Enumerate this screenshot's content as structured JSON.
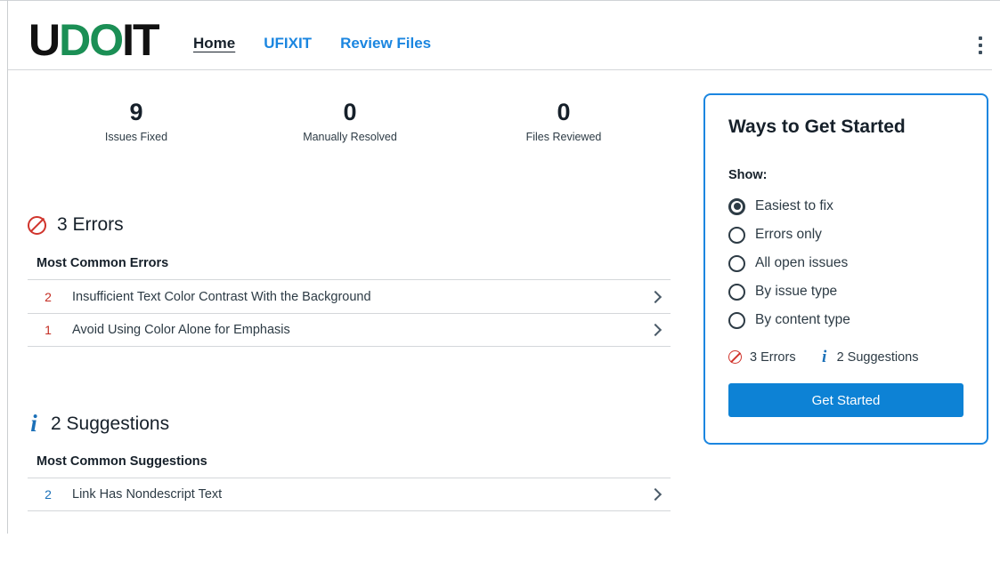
{
  "app": {
    "logo_part1": "U",
    "logo_part2": "DO",
    "logo_part3": "IT",
    "accent_blue": "#1b86e0",
    "error_red": "#d0342c",
    "suggestion_blue": "#1b70b8",
    "button_blue": "#0d82d5",
    "logo_green": "#1b8f55"
  },
  "nav": {
    "items": [
      {
        "label": "Home",
        "active": true
      },
      {
        "label": "UFIXIT",
        "active": false
      },
      {
        "label": "Review Files",
        "active": false
      }
    ],
    "menu_icon": "kebab-menu-icon"
  },
  "stats": [
    {
      "value": "9",
      "label": "Issues Fixed"
    },
    {
      "value": "0",
      "label": "Manually Resolved"
    },
    {
      "value": "0",
      "label": "Files Reviewed"
    }
  ],
  "errors_section": {
    "icon": "error-prohibition-icon",
    "heading": "3 Errors",
    "list_title": "Most Common Errors",
    "rows": [
      {
        "count": "2",
        "label": "Insufficient Text Color Contrast With the Background"
      },
      {
        "count": "1",
        "label": "Avoid Using Color Alone for Emphasis"
      }
    ]
  },
  "suggestions_section": {
    "icon": "info-italic-icon",
    "icon_glyph": "i",
    "heading": "2 Suggestions",
    "list_title": "Most Common Suggestions",
    "rows": [
      {
        "count": "2",
        "label": "Link Has Nondescript Text"
      }
    ]
  },
  "panel": {
    "title": "Ways to Get Started",
    "show_label": "Show:",
    "options": [
      {
        "label": "Easiest to fix",
        "selected": true
      },
      {
        "label": "Errors only",
        "selected": false
      },
      {
        "label": "All open issues",
        "selected": false
      },
      {
        "label": "By issue type",
        "selected": false
      },
      {
        "label": "By content type",
        "selected": false
      }
    ],
    "tally_errors": "3 Errors",
    "tally_suggestions": "2 Suggestions",
    "tally_info_glyph": "i",
    "button_label": "Get Started"
  }
}
